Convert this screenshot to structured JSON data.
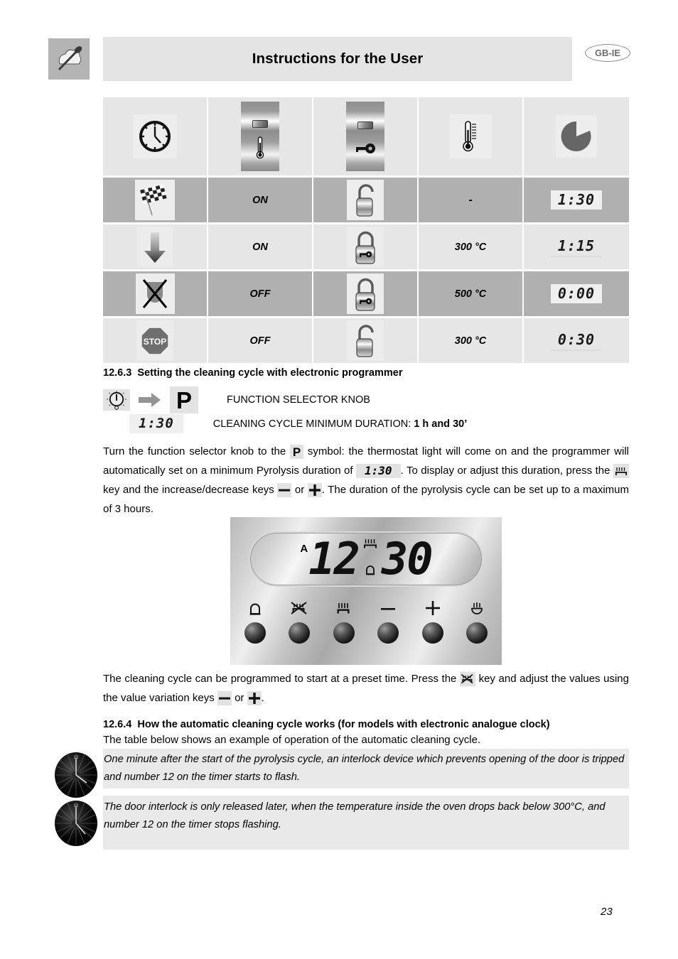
{
  "header": {
    "title": "Instructions for the User",
    "badge": "GB-IE",
    "logo_icon": "chef-hat-whisk-icon"
  },
  "table": {
    "columns": [
      {
        "icon": "clock-icon",
        "name": "time"
      },
      {
        "icon": "thermostat-indicator-light-icon",
        "name": "thermostat-light"
      },
      {
        "icon": "door-lock-indicator-light-icon",
        "name": "door-lock-light"
      },
      {
        "icon": "thermometer-icon",
        "name": "oven-temperature"
      },
      {
        "icon": "pie-timer-icon",
        "name": "remaining-duration"
      }
    ],
    "rows": [
      {
        "stage_icon": "checkered-flag-icon",
        "stage_name": "start",
        "light": "ON",
        "lock_icon": "padlock-open-icon",
        "temperature": "-",
        "duration": "1:30",
        "duration_boxed": true,
        "shade": "dark"
      },
      {
        "stage_icon": "down-arrow-icon",
        "stage_name": "heating",
        "light": "ON",
        "lock_icon": "padlock-closed-key-icon",
        "temperature": "300 °C",
        "duration": "1:15",
        "duration_boxed": false,
        "shade": "light"
      },
      {
        "stage_icon": "no-pan-crossed-icon",
        "stage_name": "pyrolysis",
        "light": "OFF",
        "lock_icon": "padlock-closed-key-icon",
        "temperature": "500 °C",
        "duration": "0:00",
        "duration_boxed": true,
        "shade": "dark"
      },
      {
        "stage_icon": "stop-sign-icon",
        "stage_name": "end",
        "light": "OFF",
        "lock_icon": "padlock-open-icon",
        "temperature": "300 °C",
        "duration": "0:30",
        "duration_boxed": false,
        "shade": "light"
      }
    ]
  },
  "section_1263": {
    "number": "12.6.3",
    "title": "Setting the cleaning cycle with electronic programmer",
    "legend": [
      {
        "knob_icon": "rotary-knob-icon",
        "arrow_icon": "right-arrow-icon",
        "symbol": "P",
        "label": "FUNCTION SELECTOR KNOB"
      },
      {
        "lcd": "1:30",
        "label_plain": "CLEANING CYCLE MINIMUM DURATION: ",
        "label_bold": "1 h and 30’"
      }
    ],
    "paragraph": {
      "p1": "Turn the function selector knob to the ",
      "sym_p": "P",
      "p2": " symbol: the thermostat light will come on and the programmer will automatically set on a minimum Pyrolysis duration of ",
      "lcd": "1:30",
      "p3": ". To display or adjust this duration, press the ",
      "icon_heat": "heating-element-icon",
      "p4": " key and the increase/decrease keys ",
      "sym_minus": "—",
      "p5": " or ",
      "sym_plus": "+",
      "p6": ". The duration of the pyrolysis cycle can be set up to a maximum of 3 hours."
    }
  },
  "programmer": {
    "display": {
      "auto_flag": "A",
      "hours": "12",
      "minutes": "30",
      "top_icon": "heating-element-icon",
      "bottom_icon": "bell-icon"
    },
    "buttons": [
      {
        "icon": "bell-icon",
        "name": "timer-button"
      },
      {
        "icon": "crossed-pan-icon",
        "name": "cooking-duration-button"
      },
      {
        "icon": "heating-element-icon",
        "name": "pyrolysis-button"
      },
      {
        "icon": "minus-icon",
        "name": "decrease-button"
      },
      {
        "icon": "plus-icon",
        "name": "increase-button"
      },
      {
        "icon": "manual-hand-icon",
        "name": "manual-button"
      }
    ]
  },
  "after_programmer": {
    "p1": "The cleaning cycle can be programmed to start at a preset time. Press the ",
    "icon_pan": "crossed-pan-icon",
    "p2": " key and adjust the values using the value variation keys ",
    "sym_minus": "—",
    "p3": " or ",
    "sym_plus": "+",
    "p4": "."
  },
  "section_1264": {
    "number": "12.6.4",
    "title": "How the automatic cleaning cycle works (for models with electronic analogue clock)",
    "intro": "The table below shows an example of operation of the automatic cleaning cycle.",
    "notes": [
      {
        "icon": "analogue-clock-icon",
        "text": "One minute after the start of the pyrolysis cycle, an interlock device which prevents opening of the door is tripped and number 12 on the timer starts to flash."
      },
      {
        "icon": "analogue-clock-icon",
        "text": "The door interlock is only released later, when the temperature inside the oven drops back below 300°C, and number 12 on the timer stops flashing."
      }
    ]
  },
  "footer": {
    "page_number": "23"
  }
}
